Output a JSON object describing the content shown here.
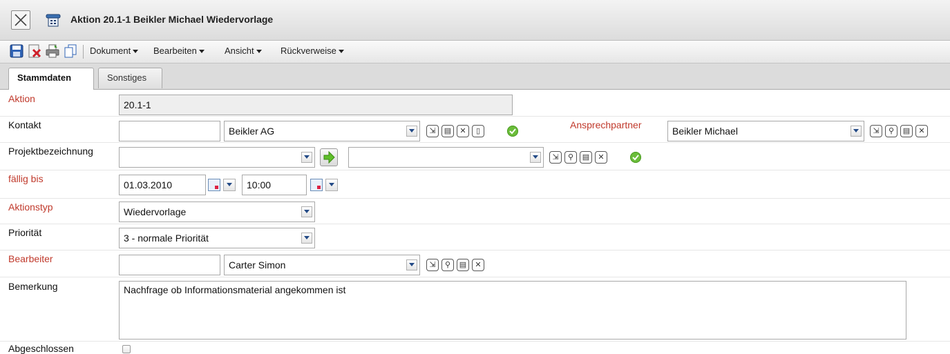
{
  "window": {
    "title": "Aktion 20.1-1 Beikler Michael Wiedervorlage"
  },
  "toolbar": {
    "menus": [
      "Dokument",
      "Bearbeiten",
      "Ansicht",
      "Rückverweise"
    ]
  },
  "tabs": [
    {
      "label": "Stammdaten",
      "active": true
    },
    {
      "label": "Sonstiges",
      "active": false
    }
  ],
  "form": {
    "aktion": {
      "label": "Aktion",
      "value": "20.1-1"
    },
    "kontakt": {
      "label": "Kontakt",
      "number": "",
      "value": "Beikler AG"
    },
    "ansprechpartner": {
      "label": "Ansprechpartner",
      "value": "Beikler Michael"
    },
    "projekt": {
      "label": "Projektbezeichnung",
      "value": "",
      "value2": ""
    },
    "faellig": {
      "label": "fällig bis",
      "date": "01.03.2010",
      "time": "10:00"
    },
    "aktionstyp": {
      "label": "Aktionstyp",
      "value": "Wiedervorlage"
    },
    "prioritaet": {
      "label": "Priorität",
      "value": "3 - normale Priorität"
    },
    "bearbeiter": {
      "label": "Bearbeiter",
      "number": "",
      "value": "Carter Simon"
    },
    "bemerkung": {
      "label": "Bemerkung",
      "value": "Nachfrage ob Informationsmaterial angekommen ist"
    },
    "abgeschlossen": {
      "label": "Abgeschlossen",
      "checked": false
    }
  },
  "colors": {
    "required_label": "#c0392b",
    "ok_icon": "#6bbd3a",
    "accent": "#234a86"
  },
  "icons": [
    "close-icon",
    "phone-icon",
    "save-icon",
    "delete-icon",
    "print-icon",
    "copy-icon",
    "open-icon",
    "search-icon",
    "clipboard-icon",
    "remove-icon",
    "new-document-icon",
    "check-icon",
    "calendar-icon",
    "arrow-right-icon"
  ]
}
